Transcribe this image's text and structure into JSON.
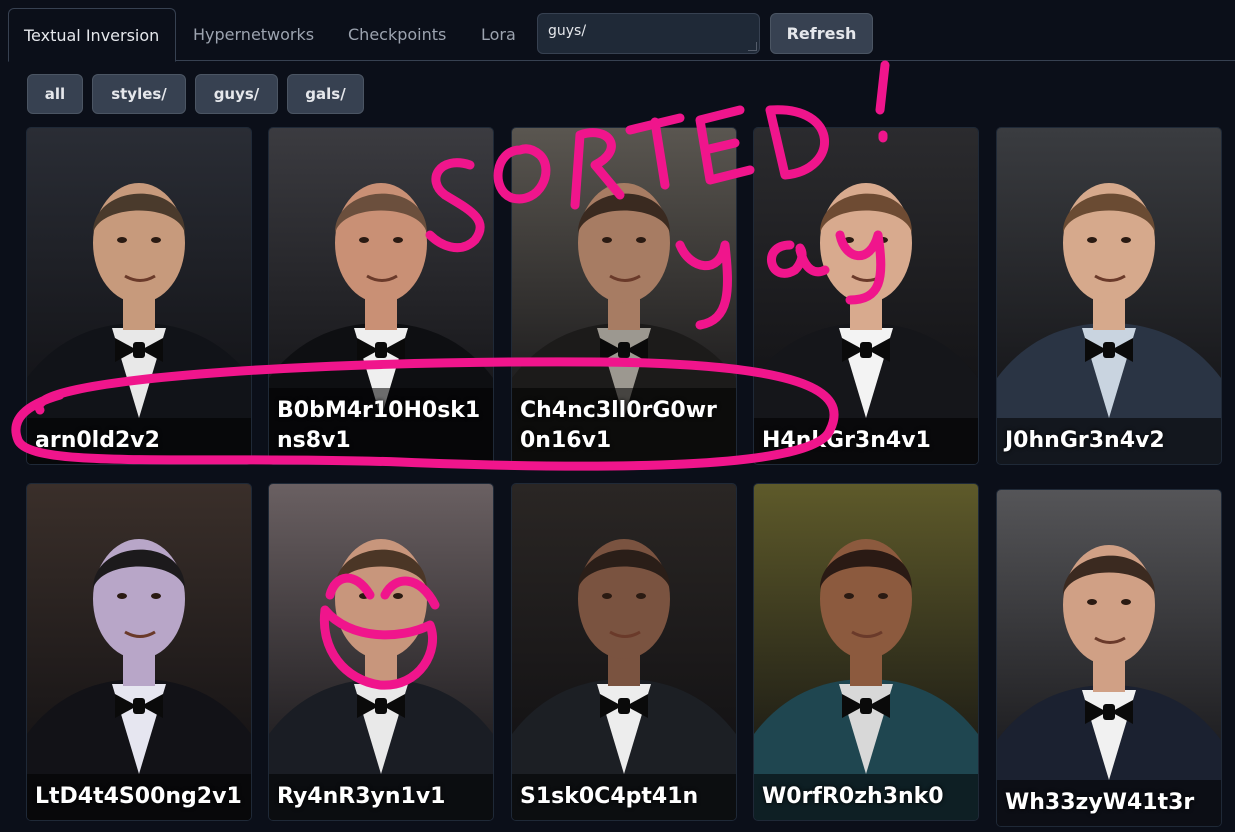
{
  "tabs": [
    {
      "label": "Textual Inversion",
      "active": true
    },
    {
      "label": "Hypernetworks",
      "active": false
    },
    {
      "label": "Checkpoints",
      "active": false
    },
    {
      "label": "Lora",
      "active": false
    }
  ],
  "search": {
    "value": "guys/"
  },
  "refresh_label": "Refresh",
  "filters": [
    "all",
    "styles/",
    "guys/",
    "gals/"
  ],
  "cards": [
    {
      "name": "arn0ld2v2",
      "bg": "#2a2d35",
      "skin": "#c79a7c",
      "hair": "#4a3a2c",
      "suit": "#111318",
      "shirt": "#e8e8e8"
    },
    {
      "name": "B0bM4r10H0sk1ns8v1",
      "bg": "#3b3b40",
      "skin": "#c99075",
      "hair": "#6b4f3d",
      "suit": "#0e0f12",
      "shirt": "#efefef"
    },
    {
      "name": "Ch4nc3ll0rG0wr0n16v1",
      "bg": "#5a5650",
      "skin": "#a77c63",
      "hair": "#3a2a20",
      "suit": "#1c1b1a",
      "shirt": "#9c9890"
    },
    {
      "name": "H4nkGr3n4v1",
      "bg": "#2b2b2e",
      "skin": "#d8aa8e",
      "hair": "#6e4b33",
      "suit": "#15161a",
      "shirt": "#f3f3f3"
    },
    {
      "name": "J0hnGr3n4v2",
      "bg": "#3a3c40",
      "skin": "#d6a98c",
      "hair": "#6a4b33",
      "suit": "#2a3444",
      "shirt": "#c9d4e0"
    },
    {
      "name": "LtD4t4S00ng2v1",
      "bg": "#3a2f2a",
      "skin": "#b8a6c8",
      "hair": "#1c1a1c",
      "suit": "#121217",
      "shirt": "#e6e6f0"
    },
    {
      "name": "Ry4nR3yn1v1",
      "bg": "#6a6062",
      "skin": "#c8967c",
      "hair": "#4b3626",
      "suit": "#1a1d24",
      "shirt": "#e9e9e9"
    },
    {
      "name": "S1sk0C4pt41n",
      "bg": "#2a2624",
      "skin": "#7a5340",
      "hair": "#2a1e18",
      "suit": "#1c1f24",
      "shirt": "#ededed"
    },
    {
      "name": "W0rfR0zh3nk0",
      "bg": "#5e5a2a",
      "skin": "#8c5a3e",
      "hair": "#2a1a14",
      "suit": "#1f4650",
      "shirt": "#d8d8d8"
    },
    {
      "name": "Wh33zyW41t3r",
      "bg": "#555558",
      "skin": "#d0a085",
      "hair": "#3b2a20",
      "suit": "#1b2130",
      "shirt": "#f1f1f1"
    }
  ],
  "annotation": {
    "text_sorted": "SORTED!",
    "text_yay": "yay",
    "color": "#f0158c"
  }
}
